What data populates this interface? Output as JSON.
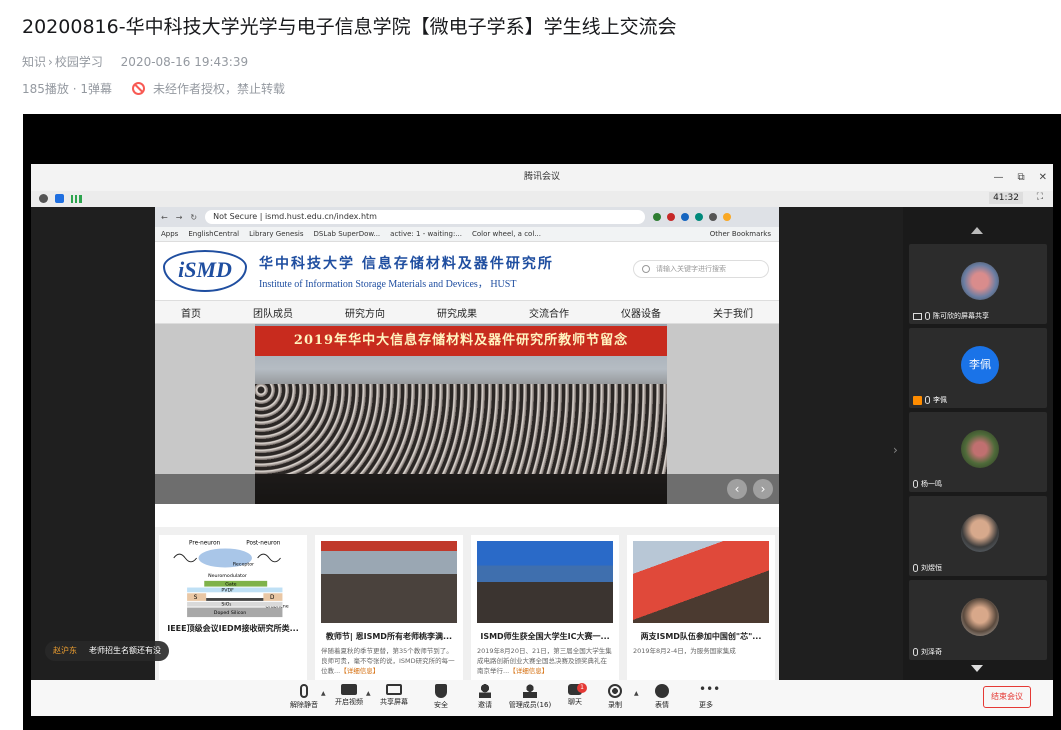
{
  "page": {
    "title": "20200816-华中科技大学光学与电子信息学院【微电子学系】学生线上交流会",
    "category": "知识",
    "subcategory": "校园学习",
    "datetime": "2020-08-16 19:43:39",
    "plays": "185播放",
    "danmaku": "1弹幕",
    "stats_sep": "·",
    "copyright": "未经作者授权，禁止转载"
  },
  "meeting": {
    "window_title": "腾讯会议",
    "window_controls": [
      "—",
      "⧉",
      "✕"
    ],
    "timer": "41:32",
    "fullscreen": "⛶",
    "browser": {
      "address": "Not Secure | ismd.hust.edu.cn/index.htm",
      "bookmarks": [
        "Apps",
        "EnglishCentral",
        "Library Genesis",
        "DSLab SuperDow...",
        "active: 1 - waiting:...",
        "Color wheel, a col..."
      ],
      "other_bookmarks": "Other Bookmarks"
    },
    "site": {
      "logo": "iSMD",
      "name_cn": "华中科技大学 信息存储材料及器件研究所",
      "name_en": "Institute of Information Storage Materials and Devices， HUST",
      "search_placeholder": "请输入关键字进行搜索",
      "nav": [
        "首页",
        "团队成员",
        "研究方向",
        "研究成果",
        "交流合作",
        "仪器设备",
        "关于我们"
      ],
      "banner_title": "2019年华中大信息存储材料及器件研究所教师节留念",
      "prev": "‹",
      "next": "›",
      "cards": [
        {
          "title": "IEEE顶级会议IEDM接收研究所类...",
          "desc": "",
          "more": "",
          "figure_labels": [
            "Pre-neuron",
            "Post-neuron",
            "Receptor",
            "Neuromodulator",
            "Gate",
            "PVDF",
            "SiO₂",
            "Graphene",
            "Doped Silicon",
            "S",
            "D"
          ]
        },
        {
          "title": "教师节| 恩ISMD所有老师桃李满...",
          "desc": "伴随着夏秋的季节更替，第35个教师节到了。良师可贵，毫不夸张的说，ISMD研究所的每一位教...",
          "more": "【详细信息】"
        },
        {
          "title": "ISMD师生获全国大学生IC大赛一...",
          "desc": "2019年8月20日、21日，第三届全国大学生集成电路创新创业大赛全国总决赛及颁奖典礼在南京举行...",
          "more": "【详细信息】"
        },
        {
          "title": "两支ISMD队伍参加中国创\"芯\"...",
          "desc": "2019年8月2-4日，为服务国家集成",
          "more": ""
        }
      ]
    },
    "caption": {
      "speaker": "赵沪东",
      "text": "老师招生名额还有没"
    },
    "participants": [
      {
        "name": "陈可欣的屏幕共享",
        "avatar_text": ""
      },
      {
        "name": "李佩",
        "avatar_text": "李佩"
      },
      {
        "name": "杨一鸣",
        "avatar_text": ""
      },
      {
        "name": "刘煜恒",
        "avatar_text": ""
      },
      {
        "name": "刘泽奇",
        "avatar_text": ""
      }
    ],
    "toolbar": {
      "items": [
        "解除静音",
        "开启视频",
        "共享屏幕",
        "安全",
        "邀请",
        "管理成员(16)",
        "聊天",
        "录制",
        "表情",
        "更多"
      ],
      "chat_badge": "1",
      "end": "结束会议"
    }
  },
  "colors": {
    "end_button": "#e53935",
    "avatar_blue": "#1a73e8",
    "brand_blue": "#1f4ea0",
    "banner_red": "#c82b1e"
  }
}
